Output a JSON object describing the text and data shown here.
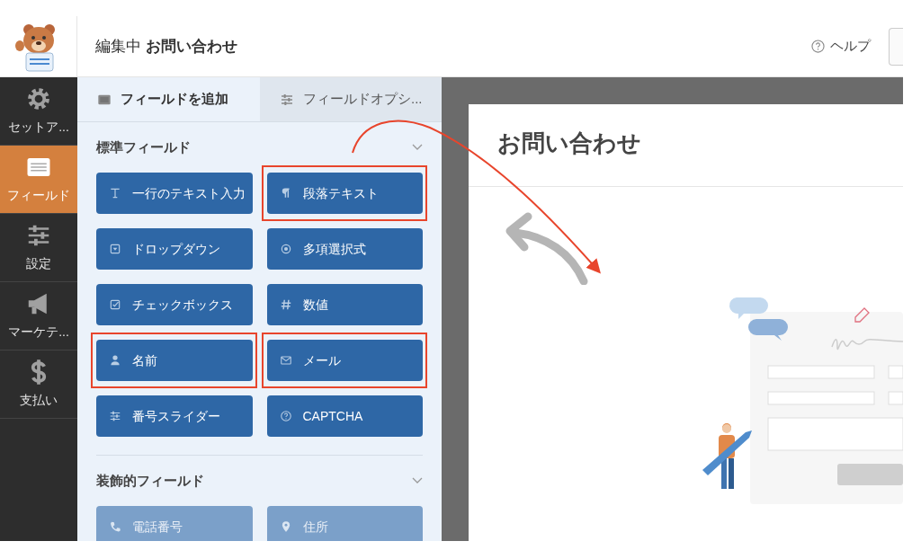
{
  "header": {
    "title": "編集中 **お問い合わせ**",
    "help": "ヘルプ"
  },
  "sidebar": {
    "items": [
      {
        "label": "セットア...",
        "kind": "gear",
        "selected": false
      },
      {
        "label": "フィールド",
        "kind": "list",
        "selected": true
      },
      {
        "label": "設定",
        "kind": "sliders",
        "selected": false
      },
      {
        "label": "マーケテ...",
        "kind": "megaphone",
        "selected": false
      },
      {
        "label": "支払い",
        "kind": "dollar",
        "selected": false
      }
    ]
  },
  "tabs": [
    {
      "label": "フィールドを追加",
      "kind": "list",
      "selected": true
    },
    {
      "label": "フィールドオプシ...",
      "kind": "sliders",
      "selected": false
    }
  ],
  "sections": [
    {
      "title": "標準フィールド",
      "expanded": true,
      "disabled": false,
      "fields": [
        {
          "label": "一行のテキスト入力",
          "kind": "text",
          "highlighted": false
        },
        {
          "label": "段落テキスト",
          "kind": "paragraph",
          "highlighted": true
        },
        {
          "label": "ドロップダウン",
          "kind": "dropdown",
          "highlighted": false
        },
        {
          "label": "多項選択式",
          "kind": "radio",
          "highlighted": false
        },
        {
          "label": "チェックボックス",
          "kind": "checkbox",
          "highlighted": false
        },
        {
          "label": "数値",
          "kind": "hash",
          "highlighted": false
        },
        {
          "label": "名前",
          "kind": "person",
          "highlighted": true
        },
        {
          "label": "メール",
          "kind": "mail",
          "highlighted": true
        },
        {
          "label": "番号スライダー",
          "kind": "sliders",
          "highlighted": false
        },
        {
          "label": "CAPTCHA",
          "kind": "question",
          "highlighted": false
        }
      ]
    },
    {
      "title": "装飾的フィールド",
      "expanded": true,
      "disabled": true,
      "fields": [
        {
          "label": "電話番号",
          "kind": "phone",
          "highlighted": false
        },
        {
          "label": "住所",
          "kind": "pin",
          "highlighted": false
        }
      ]
    }
  ],
  "preview": {
    "form_title": "お問い合わせ"
  }
}
